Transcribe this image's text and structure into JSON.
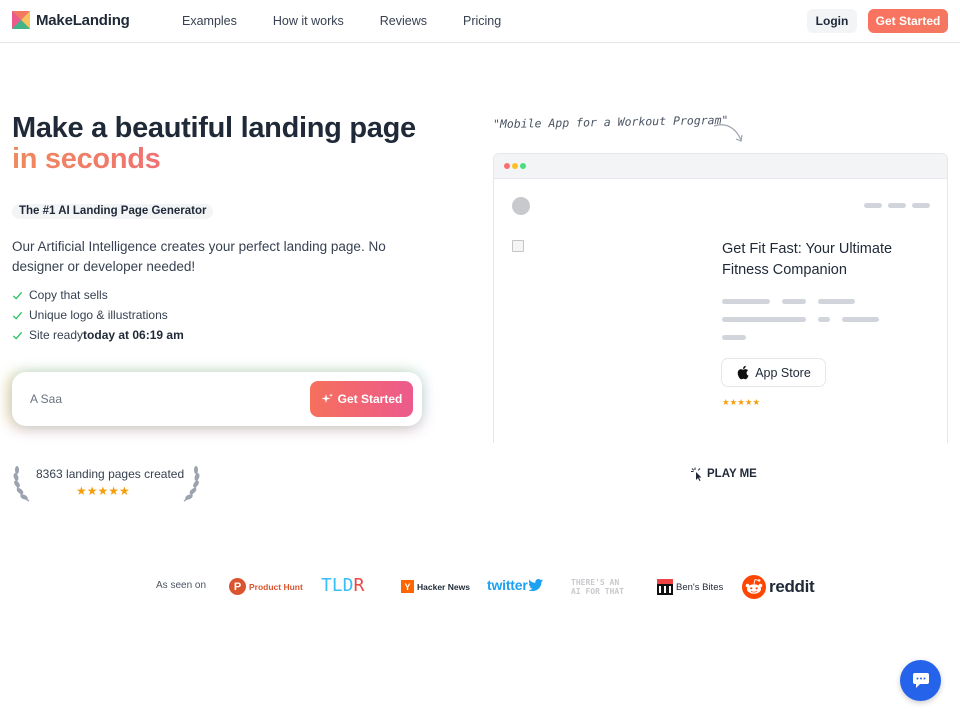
{
  "header": {
    "brand_name": "MakeLanding",
    "nav": [
      "Examples",
      "How it works",
      "Reviews",
      "Pricing"
    ],
    "login_label": "Login",
    "cta_label": "Get Started"
  },
  "hero": {
    "title_line1": "Make a beautiful landing page",
    "title_line2": "in seconds",
    "badge": "The #1 AI Landing Page Generator",
    "lede": "Our Artificial Intelligence creates your perfect landing page. No designer or developer needed!",
    "features": [
      {
        "text": "Copy that sells"
      },
      {
        "text": "Unique logo & illustrations"
      },
      {
        "text": "Site ready ",
        "bold": "today at 06:19 am"
      }
    ],
    "input_value": "A Saa",
    "cta_label": "Get Started"
  },
  "counter": {
    "text": "8363 landing pages created",
    "rating": 5,
    "stars": "★★★★★"
  },
  "preview": {
    "caption": "\"Mobile App for a Workout Program\"",
    "title": "Get Fit Fast: Your Ultimate Fitness Companion",
    "app_store_label": "App Store",
    "rating": 5,
    "stars": "★★★★★",
    "dot_colors": [
      "#f87171",
      "#fbbf24",
      "#4ade80"
    ]
  },
  "play_me": {
    "label": "PLAY ME"
  },
  "press": {
    "label": "As seen on",
    "product_hunt": {
      "letter": "P",
      "text": "Product Hunt"
    },
    "tldr": {
      "prefix": "TLD",
      "suffix": "R"
    },
    "hacker_news": {
      "letter": "Y",
      "text": "Hacker News"
    },
    "twitter": "twitter",
    "aift": {
      "line1": "THERE'S AN",
      "line2": "AI FOR THAT"
    },
    "bens_bites": "Ben's Bites",
    "reddit": "reddit"
  },
  "colors": {
    "accent": "#f97360",
    "gradient_start": "#f08a5d",
    "gradient_end": "#ec4899",
    "chat_button": "#2563eb",
    "star": "#f59e0b",
    "check": "#22c55e"
  },
  "icons": {
    "brand": "envelope-logo-icon",
    "check": "check-icon",
    "sparkle": "sparkle-icon",
    "apple": "apple-icon",
    "pointer": "click-pointer-icon",
    "chat": "chat-bubble-icon"
  }
}
